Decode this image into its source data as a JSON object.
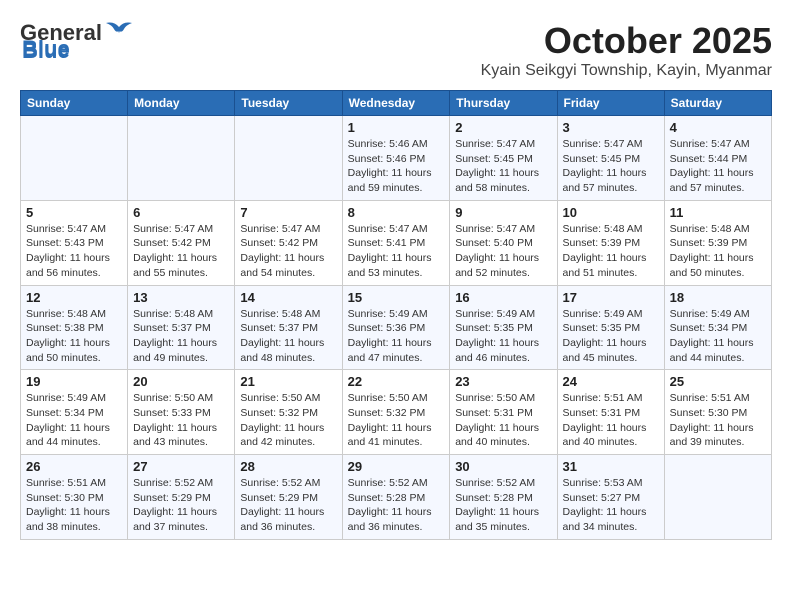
{
  "logo": {
    "general": "General",
    "blue": "Blue"
  },
  "title": "October 2025",
  "location": "Kyain Seikgyi Township, Kayin, Myanmar",
  "headers": [
    "Sunday",
    "Monday",
    "Tuesday",
    "Wednesday",
    "Thursday",
    "Friday",
    "Saturday"
  ],
  "weeks": [
    [
      {
        "day": "",
        "info": ""
      },
      {
        "day": "",
        "info": ""
      },
      {
        "day": "",
        "info": ""
      },
      {
        "day": "1",
        "info": "Sunrise: 5:46 AM\nSunset: 5:46 PM\nDaylight: 11 hours\nand 59 minutes."
      },
      {
        "day": "2",
        "info": "Sunrise: 5:47 AM\nSunset: 5:45 PM\nDaylight: 11 hours\nand 58 minutes."
      },
      {
        "day": "3",
        "info": "Sunrise: 5:47 AM\nSunset: 5:45 PM\nDaylight: 11 hours\nand 57 minutes."
      },
      {
        "day": "4",
        "info": "Sunrise: 5:47 AM\nSunset: 5:44 PM\nDaylight: 11 hours\nand 57 minutes."
      }
    ],
    [
      {
        "day": "5",
        "info": "Sunrise: 5:47 AM\nSunset: 5:43 PM\nDaylight: 11 hours\nand 56 minutes."
      },
      {
        "day": "6",
        "info": "Sunrise: 5:47 AM\nSunset: 5:42 PM\nDaylight: 11 hours\nand 55 minutes."
      },
      {
        "day": "7",
        "info": "Sunrise: 5:47 AM\nSunset: 5:42 PM\nDaylight: 11 hours\nand 54 minutes."
      },
      {
        "day": "8",
        "info": "Sunrise: 5:47 AM\nSunset: 5:41 PM\nDaylight: 11 hours\nand 53 minutes."
      },
      {
        "day": "9",
        "info": "Sunrise: 5:47 AM\nSunset: 5:40 PM\nDaylight: 11 hours\nand 52 minutes."
      },
      {
        "day": "10",
        "info": "Sunrise: 5:48 AM\nSunset: 5:39 PM\nDaylight: 11 hours\nand 51 minutes."
      },
      {
        "day": "11",
        "info": "Sunrise: 5:48 AM\nSunset: 5:39 PM\nDaylight: 11 hours\nand 50 minutes."
      }
    ],
    [
      {
        "day": "12",
        "info": "Sunrise: 5:48 AM\nSunset: 5:38 PM\nDaylight: 11 hours\nand 50 minutes."
      },
      {
        "day": "13",
        "info": "Sunrise: 5:48 AM\nSunset: 5:37 PM\nDaylight: 11 hours\nand 49 minutes."
      },
      {
        "day": "14",
        "info": "Sunrise: 5:48 AM\nSunset: 5:37 PM\nDaylight: 11 hours\nand 48 minutes."
      },
      {
        "day": "15",
        "info": "Sunrise: 5:49 AM\nSunset: 5:36 PM\nDaylight: 11 hours\nand 47 minutes."
      },
      {
        "day": "16",
        "info": "Sunrise: 5:49 AM\nSunset: 5:35 PM\nDaylight: 11 hours\nand 46 minutes."
      },
      {
        "day": "17",
        "info": "Sunrise: 5:49 AM\nSunset: 5:35 PM\nDaylight: 11 hours\nand 45 minutes."
      },
      {
        "day": "18",
        "info": "Sunrise: 5:49 AM\nSunset: 5:34 PM\nDaylight: 11 hours\nand 44 minutes."
      }
    ],
    [
      {
        "day": "19",
        "info": "Sunrise: 5:49 AM\nSunset: 5:34 PM\nDaylight: 11 hours\nand 44 minutes."
      },
      {
        "day": "20",
        "info": "Sunrise: 5:50 AM\nSunset: 5:33 PM\nDaylight: 11 hours\nand 43 minutes."
      },
      {
        "day": "21",
        "info": "Sunrise: 5:50 AM\nSunset: 5:32 PM\nDaylight: 11 hours\nand 42 minutes."
      },
      {
        "day": "22",
        "info": "Sunrise: 5:50 AM\nSunset: 5:32 PM\nDaylight: 11 hours\nand 41 minutes."
      },
      {
        "day": "23",
        "info": "Sunrise: 5:50 AM\nSunset: 5:31 PM\nDaylight: 11 hours\nand 40 minutes."
      },
      {
        "day": "24",
        "info": "Sunrise: 5:51 AM\nSunset: 5:31 PM\nDaylight: 11 hours\nand 40 minutes."
      },
      {
        "day": "25",
        "info": "Sunrise: 5:51 AM\nSunset: 5:30 PM\nDaylight: 11 hours\nand 39 minutes."
      }
    ],
    [
      {
        "day": "26",
        "info": "Sunrise: 5:51 AM\nSunset: 5:30 PM\nDaylight: 11 hours\nand 38 minutes."
      },
      {
        "day": "27",
        "info": "Sunrise: 5:52 AM\nSunset: 5:29 PM\nDaylight: 11 hours\nand 37 minutes."
      },
      {
        "day": "28",
        "info": "Sunrise: 5:52 AM\nSunset: 5:29 PM\nDaylight: 11 hours\nand 36 minutes."
      },
      {
        "day": "29",
        "info": "Sunrise: 5:52 AM\nSunset: 5:28 PM\nDaylight: 11 hours\nand 36 minutes."
      },
      {
        "day": "30",
        "info": "Sunrise: 5:52 AM\nSunset: 5:28 PM\nDaylight: 11 hours\nand 35 minutes."
      },
      {
        "day": "31",
        "info": "Sunrise: 5:53 AM\nSunset: 5:27 PM\nDaylight: 11 hours\nand 34 minutes."
      },
      {
        "day": "",
        "info": ""
      }
    ]
  ]
}
